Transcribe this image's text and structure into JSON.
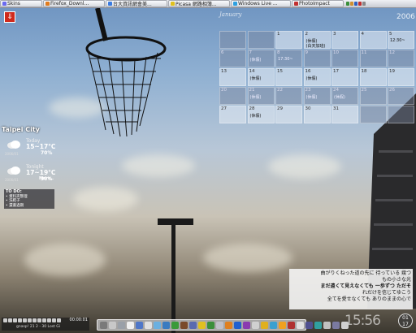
{
  "taskbar": {
    "items": [
      {
        "label": "Skins",
        "color": "#6a6af0"
      },
      {
        "label": "Firefox_Downl...",
        "color": "#e07b1d"
      },
      {
        "label": "台大資訊網會美...",
        "color": "#3a7be0"
      },
      {
        "label": "Picasa 網路相簿...",
        "color": "#e0c11d"
      },
      {
        "label": "Windows Live ...",
        "color": "#2ea0e0"
      },
      {
        "label": "PhotoImpact",
        "color": "#c23030"
      }
    ],
    "tray_colors": [
      "#3a8f3a",
      "#d09030",
      "#3060c0",
      "#c03030",
      "#888888"
    ]
  },
  "launcher": {
    "icon": "down-arrow-icon",
    "glyph": "⇓"
  },
  "calendar": {
    "month": "January",
    "year": "2006",
    "weeks": [
      [
        {
          "d": "",
          "e": ""
        },
        {
          "d": "",
          "e": ""
        },
        {
          "d": "1",
          "e": ""
        },
        {
          "d": "2",
          "e": "(休假)"
        },
        {
          "d": "3",
          "e": ""
        },
        {
          "d": "4",
          "e": ""
        },
        {
          "d": "5",
          "e": "12:30~"
        }
      ],
      [
        {
          "d": "6",
          "e": ""
        },
        {
          "d": "7",
          "e": "(休假)"
        },
        {
          "d": "8",
          "e": "17:30~"
        },
        {
          "d": "9",
          "e": ""
        },
        {
          "d": "10",
          "e": ""
        },
        {
          "d": "11",
          "e": ""
        },
        {
          "d": "12",
          "e": ""
        }
      ],
      [
        {
          "d": "13",
          "e": ""
        },
        {
          "d": "14",
          "e": "(休假)"
        },
        {
          "d": "15",
          "e": ""
        },
        {
          "d": "16",
          "e": "(休假)"
        },
        {
          "d": "17",
          "e": ""
        },
        {
          "d": "18",
          "e": ""
        },
        {
          "d": "19",
          "e": ""
        }
      ],
      [
        {
          "d": "20",
          "e": ""
        },
        {
          "d": "21",
          "e": "(休假)"
        },
        {
          "d": "22",
          "e": ""
        },
        {
          "d": "23",
          "e": "(休假)"
        },
        {
          "d": "24",
          "e": "(休假)"
        },
        {
          "d": "25",
          "e": ""
        },
        {
          "d": "26",
          "e": ""
        }
      ],
      [
        {
          "d": "27",
          "e": ""
        },
        {
          "d": "28",
          "e": "(休假)"
        },
        {
          "d": "29",
          "e": ""
        },
        {
          "d": "30",
          "e": ""
        },
        {
          "d": "31",
          "e": ""
        },
        {
          "d": "",
          "e": ""
        },
        {
          "d": "",
          "e": ""
        }
      ]
    ],
    "cell_2_extra": "(白天加班)"
  },
  "weather": {
    "city": "Taipei City",
    "today_label": "Today",
    "today_temp": "15~17°C",
    "today_pct": "70%",
    "tonight_label": "Tonight",
    "tonight_temp": "17~19°C",
    "tonight_pct": "30%",
    "more": "More..",
    "tiny_today": "2006/01",
    "tiny_tonight": "2006/01"
  },
  "todo": {
    "title": "TO DO:",
    "items": [
      "資料夾整理",
      "洗鞋子",
      "還書過期"
    ]
  },
  "lyrics": {
    "lines": [
      "曲がりくねった道の先に 待っている 幾つ",
      "もの小さな光",
      "まだ遠くて見えなくても 一歩ずつ ただそ",
      "れだけを信じてゆこう",
      "全てを愛せなくても ありのままの心で"
    ]
  },
  "clock": {
    "time": "15:56",
    "badge_top": "01",
    "badge_bottom": "17"
  },
  "media": {
    "time": "00:00:01",
    "title": "gnasp! 21 2 - 30 Lost Gi"
  },
  "dock": {
    "icon_colors": [
      "#7a7a7a",
      "#c8c8c8",
      "#9aa0a8",
      "#f0f0f0",
      "#4f77c8",
      "#e0e0e0",
      "#6bb0e0",
      "#3a7bc0",
      "#3a9a3a",
      "#7a4a2a",
      "#5a6ab0",
      "#e0c020",
      "#3a8f3a",
      "#c0c0c8",
      "#e08020",
      "#2060d0",
      "#8a3ab0",
      "#d0d0d0",
      "#e0b020",
      "#3aa0d0",
      "#f0a020",
      "#b03030",
      "#e0e0e0",
      "#505090",
      "#30a0a0",
      "#c0c0c0",
      "#7a7aa0",
      "#d0d0d0"
    ]
  }
}
